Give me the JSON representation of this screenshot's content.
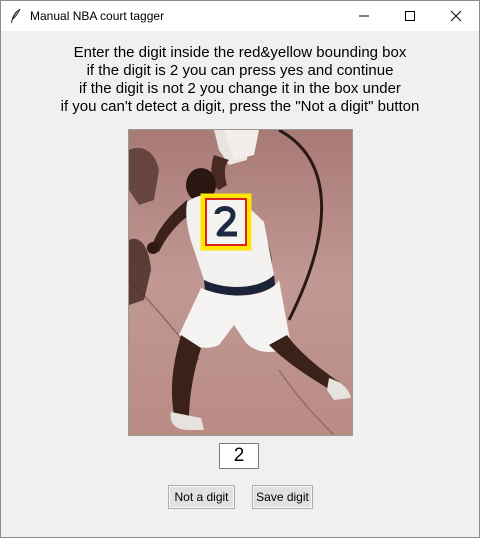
{
  "window": {
    "title": "Manual NBA court tagger",
    "app_icon": "feather-icon",
    "controls": [
      "minimize-icon",
      "maximize-icon",
      "close-icon"
    ]
  },
  "instructions": [
    "Enter the digit inside the red&yellow bounding box",
    "if the digit is 2 you can press yes and continue",
    "if the digit is not 2 you change it in the box under",
    "if you can't detect a digit, press the \"Not a digit\" button"
  ],
  "digit_entry": {
    "value": "2"
  },
  "buttons": {
    "not_digit": "Not a digit",
    "save_digit": "Save digit"
  },
  "image": {
    "jersey_digit": "2",
    "bbox_outer_color": "#ffe600",
    "bbox_inner_color": "#e0201a"
  }
}
